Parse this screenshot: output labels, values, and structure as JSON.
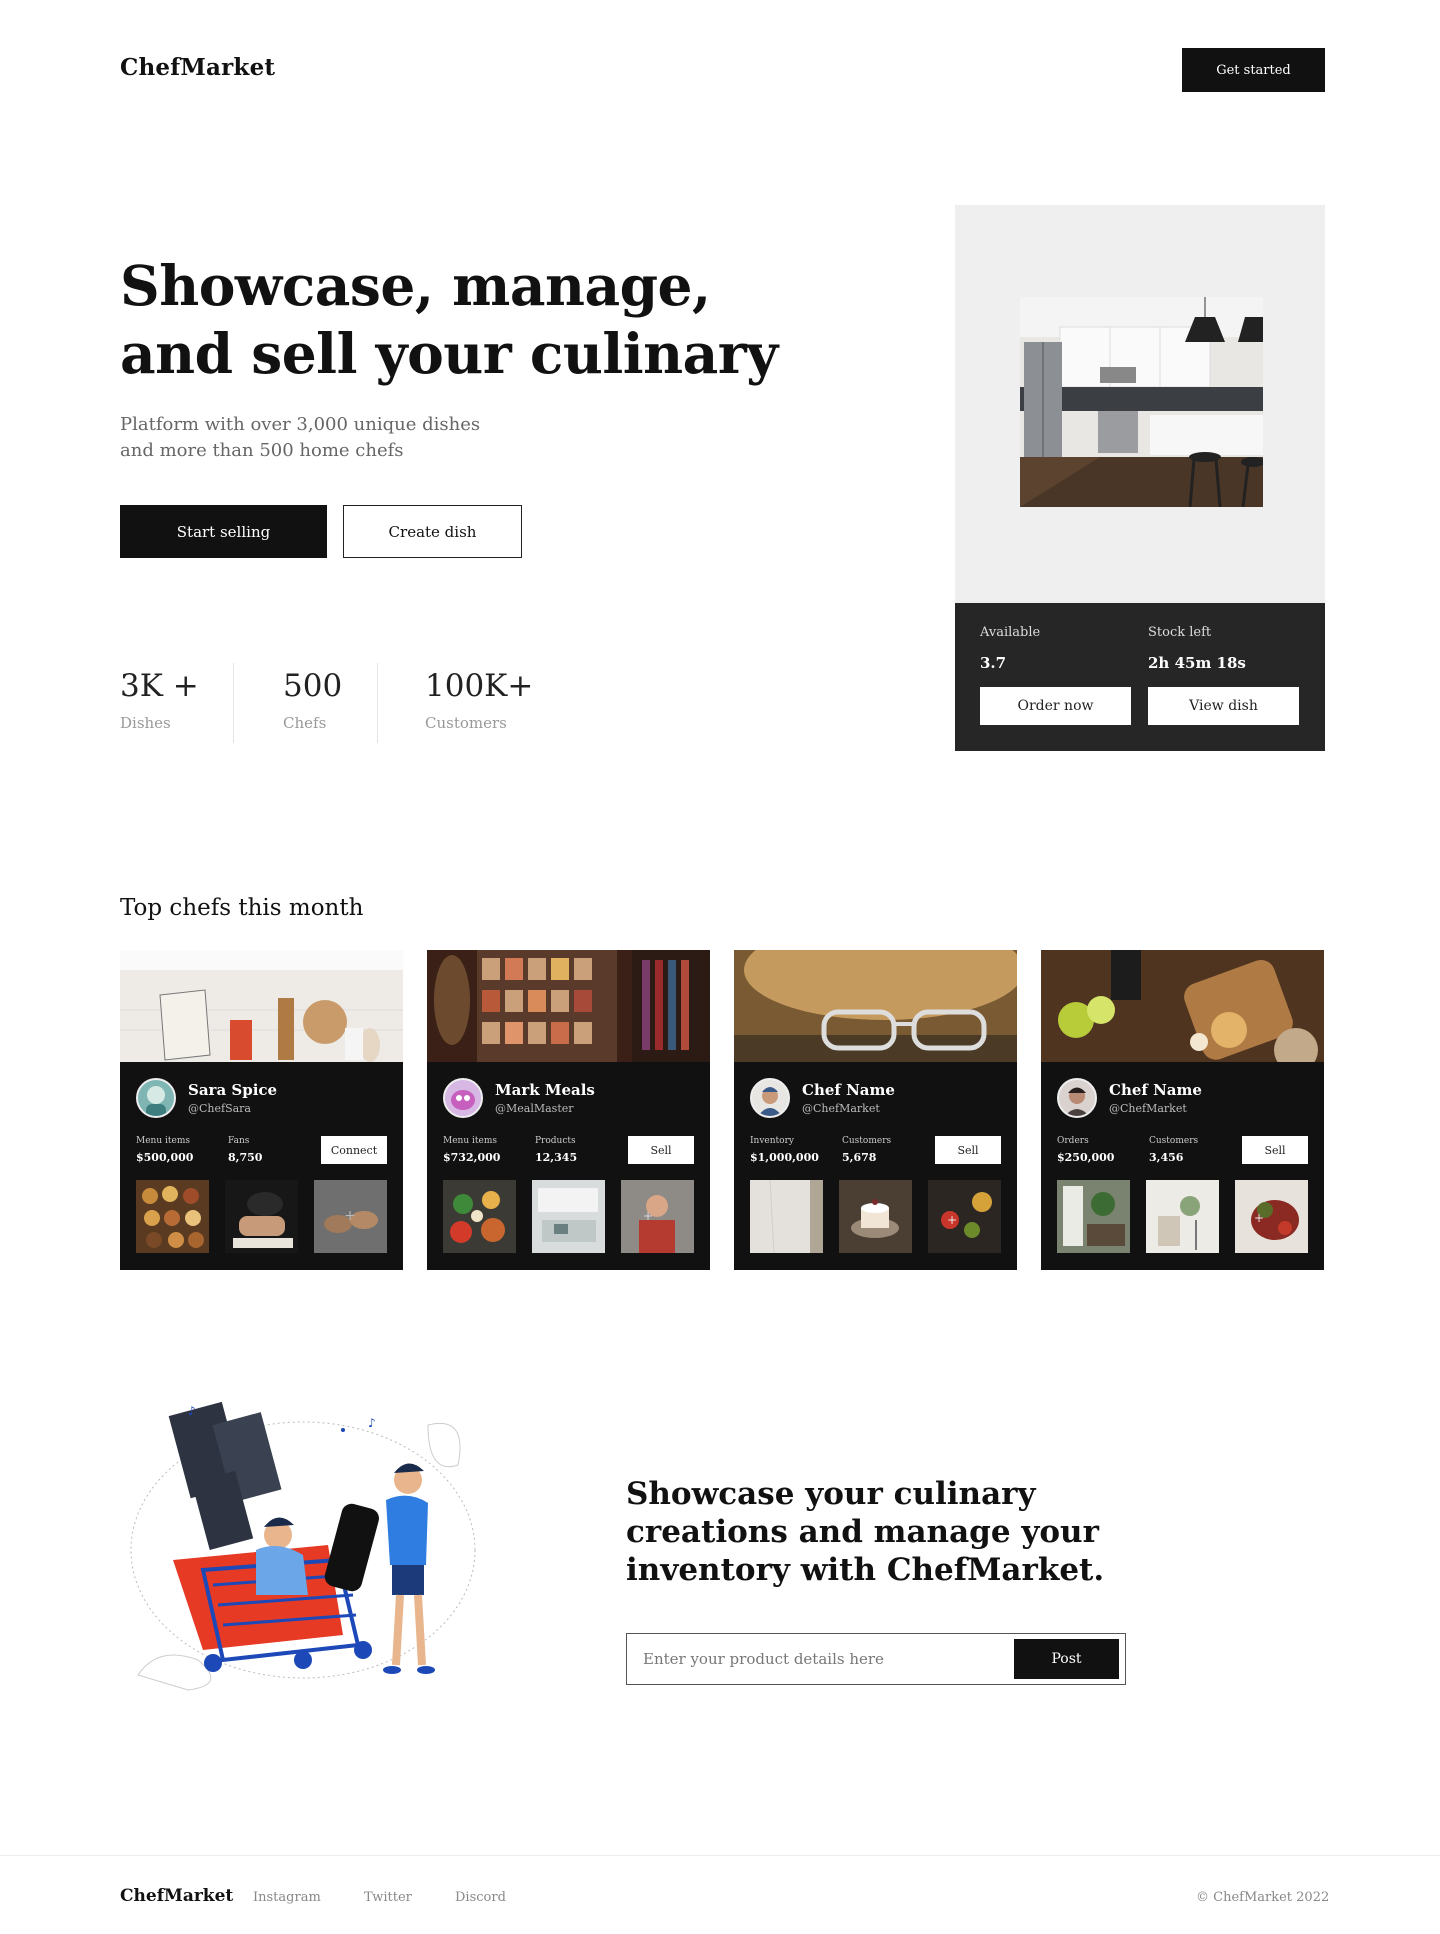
{
  "header": {
    "logo": "ChefMarket",
    "cta": "Get started"
  },
  "hero": {
    "title": "Showcase, manage, and sell your culinary",
    "subtitle_line1": "Platform with over 3,000 unique dishes",
    "subtitle_line2": "and more than 500 home chefs",
    "primary_button": "Start selling",
    "secondary_button": "Create dish",
    "stats": [
      {
        "value": "3K +",
        "label": "Dishes"
      },
      {
        "value": "500",
        "label": "Chefs"
      },
      {
        "value": "100K+",
        "label": "Customers"
      }
    ]
  },
  "product": {
    "available_label": "Available",
    "available_value": "3.7",
    "stock_label": "Stock left",
    "stock_value": "2h 45m 18s",
    "order_button": "Order now",
    "view_button": "View dish"
  },
  "top_chefs": {
    "title": "Top chefs this month",
    "chefs": [
      {
        "name": "Sara Spice",
        "handle": "@ChefSara",
        "stat1_label": "Menu items",
        "stat1_value": "$500,000",
        "stat2_label": "Fans",
        "stat2_value": "8,750",
        "button": "Connect"
      },
      {
        "name": "Mark Meals",
        "handle": "@MealMaster",
        "stat1_label": "Menu items",
        "stat1_value": "$732,000",
        "stat2_label": "Products",
        "stat2_value": "12,345",
        "button": "Sell"
      },
      {
        "name": "Chef Name",
        "handle": "@ChefMarket",
        "stat1_label": "Inventory",
        "stat1_value": "$1,000,000",
        "stat2_label": "Customers",
        "stat2_value": "5,678",
        "button": "Sell"
      },
      {
        "name": "Chef Name",
        "handle": "@ChefMarket",
        "stat1_label": "Orders",
        "stat1_value": "$250,000",
        "stat2_label": "Customers",
        "stat2_value": "3,456",
        "button": "Sell"
      }
    ]
  },
  "cta": {
    "title": "Showcase your culinary creations and manage your inventory with ChefMarket.",
    "input_placeholder": "Enter your product details here",
    "button": "Post"
  },
  "footer": {
    "logo": "ChefMarket",
    "links": [
      "Instagram",
      "Twitter",
      "Discord"
    ],
    "copyright": "© ChefMarket 2022"
  }
}
